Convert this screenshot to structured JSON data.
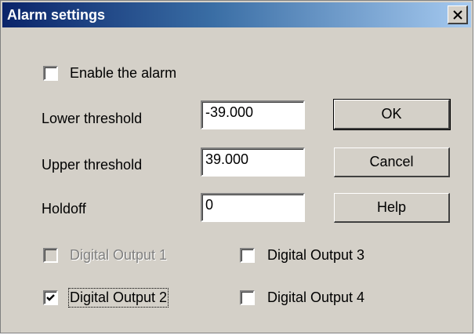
{
  "dialog": {
    "title": "Alarm settings",
    "close_glyph": "×"
  },
  "enable": {
    "label": "Enable the alarm",
    "checked": false
  },
  "lower": {
    "label": "Lower threshold",
    "value": "-39.000"
  },
  "upper": {
    "label": "Upper threshold",
    "value": "39.000"
  },
  "holdoff": {
    "label": "Holdoff",
    "value": "0"
  },
  "buttons": {
    "ok": "OK",
    "cancel": "Cancel",
    "help": "Help"
  },
  "outputs": [
    {
      "label": "Digital Output 1",
      "checked": false,
      "enabled": false
    },
    {
      "label": "Digital Output 2",
      "checked": true,
      "enabled": true
    },
    {
      "label": "Digital Output 3",
      "checked": false,
      "enabled": true
    },
    {
      "label": "Digital Output 4",
      "checked": false,
      "enabled": true
    }
  ],
  "colors": {
    "title_start": "#0a246a",
    "title_end": "#a6caf0",
    "face": "#d4d0c8"
  }
}
